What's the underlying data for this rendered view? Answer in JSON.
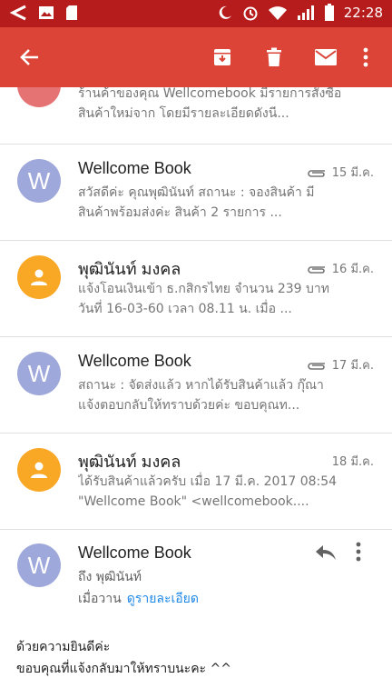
{
  "status_bar": {
    "time": "22:28"
  },
  "toolbar": {
    "icons": [
      "back-icon",
      "archive-icon",
      "delete-icon",
      "mail-icon",
      "more-icon"
    ]
  },
  "partial_row": {
    "line1": "ร้านค้าของคุณ Wellcomebook มีรายการสั่งซื้อ",
    "line2": "สินค้าใหม่จาก โดยมีรายละเอียดดังนี..."
  },
  "emails": [
    {
      "sender": "Wellcome Book",
      "date": "15 มี.ค.",
      "attachment": true,
      "avatar": "W",
      "avatar_type": "letter",
      "line1": "สวัสดีค่ะ คุณพุฒินันท์ สถานะ : จองสินค้า มี",
      "line2": "สินค้าพร้อมส่งค่ะ สินค้า 2 รายการ ..."
    },
    {
      "sender": "พุฒินันท์ มงคล",
      "date": "16 มี.ค.",
      "attachment": true,
      "avatar": "",
      "avatar_type": "person",
      "line1": "แจ้งโอนเงินเข้า ธ.กสิกรไทย จำนวน 239 บาท",
      "line2": "วันที่ 16-03-60 เวลา 08.11 น. เมื่อ ..."
    },
    {
      "sender": "Wellcome Book",
      "date": "17 มี.ค.",
      "attachment": true,
      "avatar": "W",
      "avatar_type": "letter",
      "line1": "สถานะ : จัดส่งแล้ว หากได้รับสินค้าแล้ว กุ๊ณา",
      "line2": "แจ้งตอบกลับให้ทราบด้วยค่ะ ขอบคุณท..."
    },
    {
      "sender": "พุฒินันท์ มงคล",
      "date": "18 มี.ค.",
      "attachment": false,
      "avatar": "",
      "avatar_type": "person",
      "line1": "ได้รับสินค้าแล้วครับ เมื่อ 17 มี.ค. 2017 08:54",
      "line2": "\"Wellcome Book\" <wellcomebook...."
    }
  ],
  "detail": {
    "avatar": "W",
    "sender": "Wellcome Book",
    "to": "ถึง พุฒินันท์",
    "when": "เมื่อวาน",
    "details_link": "ดูรายละเอียด",
    "body_line1": "ด้วยความยินดีค่ะ",
    "body_line2": "ขอบคุณที่แจ้งกลับมาให้ทราบนะคะ ^^"
  },
  "colors": {
    "status_bar": "#b71c1c",
    "toolbar": "#db4437",
    "avatar_w": "#9fa8da",
    "avatar_person": "#f9a825",
    "link": "#1e88e5"
  }
}
